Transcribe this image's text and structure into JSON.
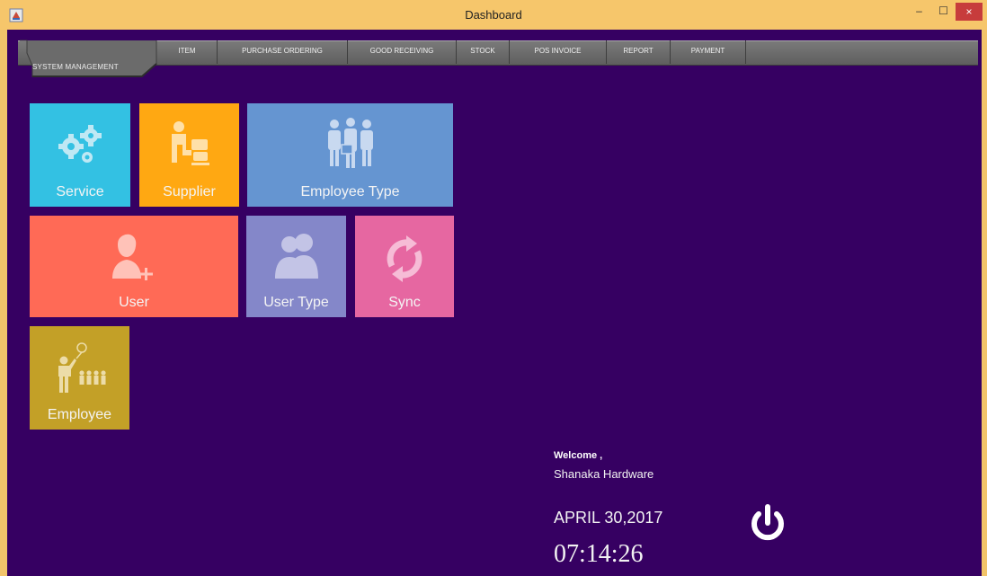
{
  "window": {
    "title": "Dashboard",
    "controls": {
      "minimize": "–",
      "maximize": "☐",
      "close": "×"
    }
  },
  "menu": {
    "system_management": "SYSTEM MANAGEMENT",
    "items": [
      {
        "label": "ITEM"
      },
      {
        "label": "PURCHASE ORDERING"
      },
      {
        "label": "GOOD RECEIVING"
      },
      {
        "label": "STOCK"
      },
      {
        "label": "POS INVOICE"
      },
      {
        "label": "REPORT"
      },
      {
        "label": "PAYMENT"
      }
    ]
  },
  "tiles": {
    "service": {
      "label": "Service",
      "color": "#33c1e3",
      "icon": "gears-icon"
    },
    "supplier": {
      "label": "Supplier",
      "color": "#ffa812",
      "icon": "supplier-icon"
    },
    "employee_type": {
      "label": "Employee Type",
      "color": "#6595d1",
      "icon": "employee-group-icon"
    },
    "user": {
      "label": "User",
      "color": "#ff6a56",
      "icon": "add-user-icon"
    },
    "user_type": {
      "label": "User Type",
      "color": "#8487c9",
      "icon": "users-icon"
    },
    "sync": {
      "label": "Sync",
      "color": "#e667a1",
      "icon": "sync-icon"
    },
    "employee": {
      "label": "Employee",
      "color": "#c3a027",
      "icon": "presenter-icon"
    }
  },
  "status": {
    "welcome": "Welcome ,",
    "company": "Shanaka Hardware",
    "date": "APRIL  30,2017",
    "time": "07:14:26"
  },
  "colors": {
    "background": "#360062",
    "titlebar": "#f6c66b",
    "menubar": "#6a6a6a"
  }
}
